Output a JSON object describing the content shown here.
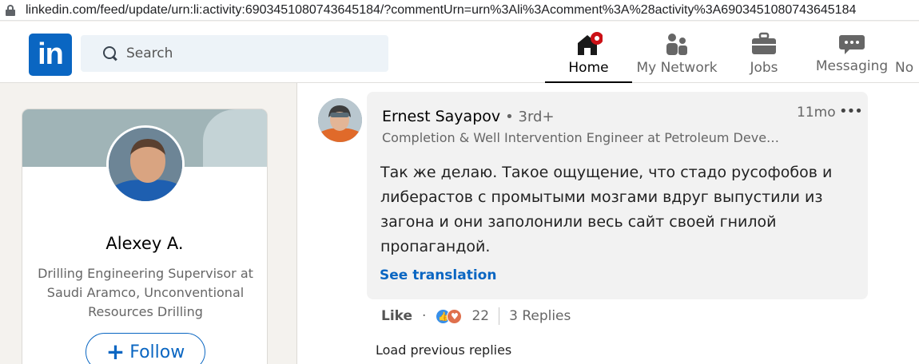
{
  "browser": {
    "url": "linkedin.com/feed/update/urn:li:activity:6903451080743645184/?commentUrn=urn%3Ali%3Acomment%3A%28activity%3A6903451080743645184"
  },
  "topnav": {
    "logo_text": "in",
    "search_placeholder": "Search",
    "items": [
      {
        "label": "Home",
        "icon": "home-icon",
        "active": true
      },
      {
        "label": "My Network",
        "icon": "network-icon"
      },
      {
        "label": "Jobs",
        "icon": "briefcase-icon"
      },
      {
        "label": "Messaging",
        "icon": "messaging-icon"
      },
      {
        "label": "No",
        "icon": "bell-icon"
      }
    ]
  },
  "profile": {
    "name": "Alexey A.",
    "headline": "Drilling Engineering Supervisor at Saudi Aramco, Unconventional Resources Drilling",
    "follow_label": "Follow"
  },
  "comment": {
    "author": "Ernest Sayapov",
    "degree": "• 3rd+",
    "timestamp": "11mo",
    "subtitle": "Completion & Well Intervention Engineer at Petroleum Deve…",
    "text": "Так же делаю. Такое ощущение, что стадо русофобов и либерастов с промытыми мозгами вдруг выпустили из загона и они заполонили весь сайт своей гнилой пропагандой.",
    "see_translation": "See translation",
    "like_label": "Like",
    "separator": "·",
    "reaction_count": "22",
    "replies_label": "3 Replies"
  },
  "load_previous": "Load previous replies",
  "colors": {
    "brand": "#0a66c2",
    "notification": "#cc1016"
  }
}
